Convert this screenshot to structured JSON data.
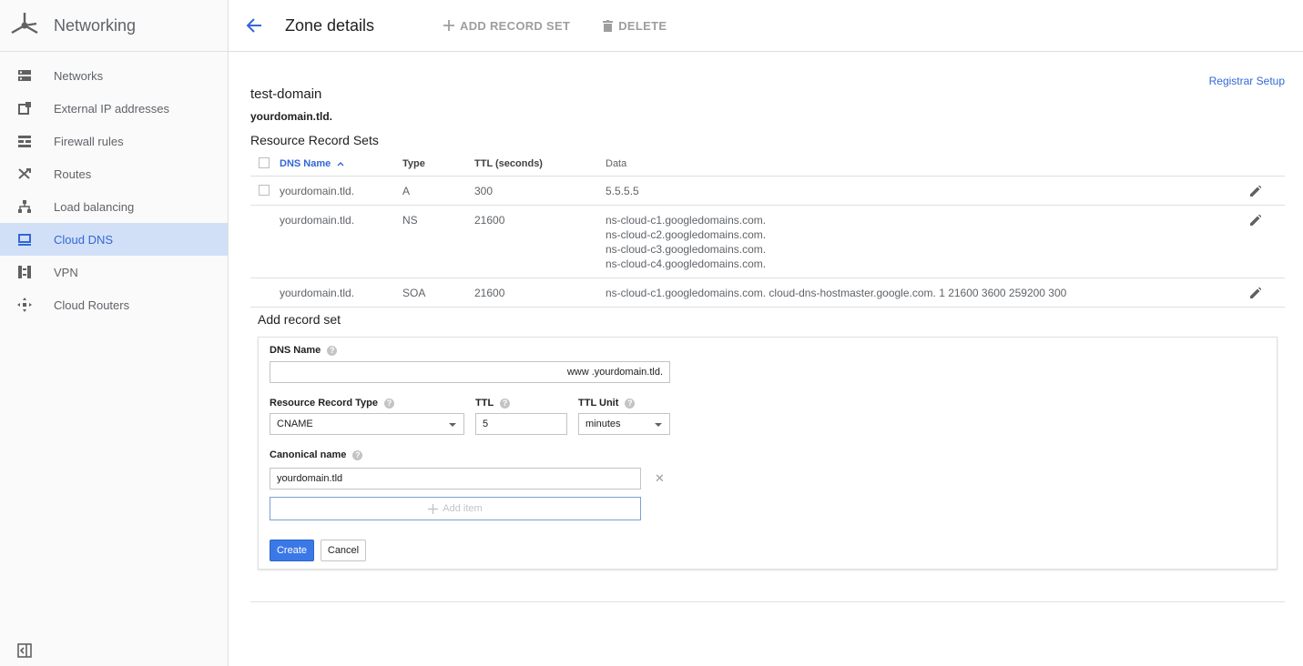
{
  "sidebar": {
    "title": "Networking",
    "items": [
      {
        "label": "Networks",
        "icon": "networks-icon"
      },
      {
        "label": "External IP addresses",
        "icon": "external-ip-icon"
      },
      {
        "label": "Firewall rules",
        "icon": "firewall-icon"
      },
      {
        "label": "Routes",
        "icon": "routes-icon"
      },
      {
        "label": "Load balancing",
        "icon": "load-balancing-icon"
      },
      {
        "label": "Cloud DNS",
        "icon": "cloud-dns-icon",
        "active": true
      },
      {
        "label": "VPN",
        "icon": "vpn-icon"
      },
      {
        "label": "Cloud Routers",
        "icon": "cloud-routers-icon"
      }
    ]
  },
  "header": {
    "title": "Zone details",
    "add_record_set": "ADD RECORD SET",
    "delete": "DELETE"
  },
  "zone": {
    "name": "test-domain",
    "dns_name": "yourdomain.tld.",
    "registrar_setup": "Registrar Setup"
  },
  "records": {
    "title": "Resource Record Sets",
    "columns": {
      "dns_name": "DNS Name",
      "type": "Type",
      "ttl": "TTL (seconds)",
      "data": "Data"
    },
    "rows": [
      {
        "dns_name": "yourdomain.tld.",
        "type": "A",
        "ttl": "300",
        "data": [
          "5.5.5.5"
        ]
      },
      {
        "dns_name": "yourdomain.tld.",
        "type": "NS",
        "ttl": "21600",
        "data": [
          "ns-cloud-c1.googledomains.com.",
          "ns-cloud-c2.googledomains.com.",
          "ns-cloud-c3.googledomains.com.",
          "ns-cloud-c4.googledomains.com."
        ]
      },
      {
        "dns_name": "yourdomain.tld.",
        "type": "SOA",
        "ttl": "21600",
        "data": [
          "ns-cloud-c1.googledomains.com. cloud-dns-hostmaster.google.com. 1 21600 3600 259200 300"
        ]
      }
    ]
  },
  "add_form": {
    "title": "Add record set",
    "dns_name_label": "DNS Name",
    "dns_name_value": "www",
    "dns_name_suffix": ".yourdomain.tld.",
    "rr_type_label": "Resource Record Type",
    "rr_type_value": "CNAME",
    "ttl_label": "TTL",
    "ttl_value": "5",
    "ttl_unit_label": "TTL Unit",
    "ttl_unit_value": "minutes",
    "canonical_label": "Canonical name",
    "canonical_value": "yourdomain.tld",
    "add_item": "Add item",
    "create": "Create",
    "cancel": "Cancel"
  },
  "colors": {
    "accent": "#3367d6",
    "active_bg": "#d2e0f7",
    "primary_button": "#3b78e7"
  }
}
